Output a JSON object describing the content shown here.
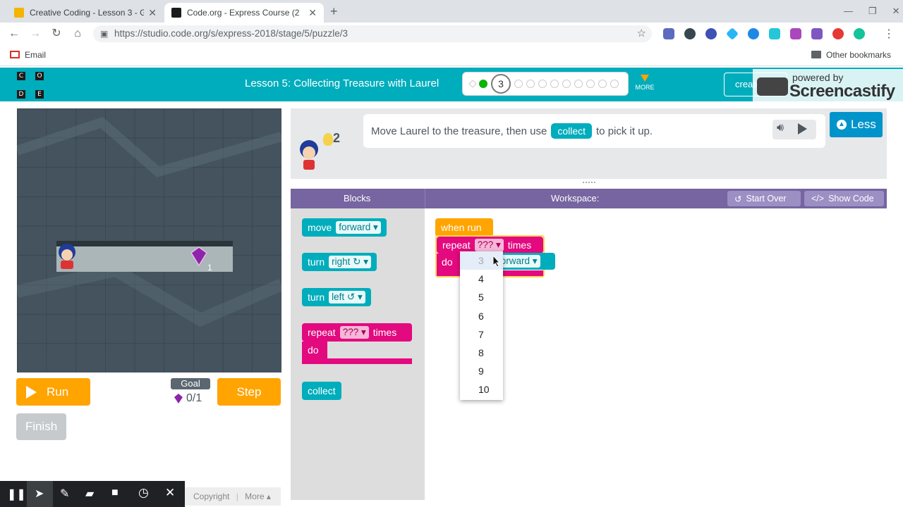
{
  "browser": {
    "tabs": [
      {
        "label": "Creative Coding - Lesson 3 - Goo",
        "favicon_color": "#f4b400"
      },
      {
        "label": "Code.org - Express Course (2",
        "favicon_color": "#1b1b1b"
      }
    ],
    "url_host": "https://studio.code.org",
    "url_path": "/s/express-2018/stage/5/puzzle/3",
    "bookmarks": {
      "email": "Email",
      "other": "Other bookmarks"
    }
  },
  "header": {
    "logo_letters": [
      "C",
      "O",
      "D",
      "E"
    ],
    "lesson_title": "Lesson 5: Collecting Treasure with Laurel",
    "current_puzzle": "3",
    "more_label": "MORE",
    "create_label": "create",
    "watermark_top": "powered by",
    "watermark_brand": "Screencastify"
  },
  "game": {
    "run_label": "Run",
    "goal_label": "Goal",
    "goal_count": "0/1",
    "treasure_count": "1",
    "step_label": "Step",
    "finish_label": "Finish"
  },
  "instructions": {
    "hint_count": "2",
    "text_before": "Move Laurel to the treasure, then use",
    "chip": "collect",
    "text_after": "to pick it up.",
    "less_label": "Less"
  },
  "workspace": {
    "blocks_header": "Blocks",
    "workspace_header": "Workspace:",
    "start_over": "Start Over",
    "show_code": "Show Code",
    "palette": {
      "move": "move",
      "forward": "forward",
      "turn": "turn",
      "right": "right ↻",
      "left": "left ↺",
      "repeat": "repeat",
      "qqq": "???",
      "times": "times",
      "do": "do",
      "collect": "collect"
    },
    "script": {
      "when_run": "when run",
      "repeat": "repeat",
      "qqq": "???",
      "times": "times",
      "do": "do",
      "forward_partial": "forward"
    },
    "dropdown_options": [
      "3",
      "4",
      "5",
      "6",
      "7",
      "8",
      "9",
      "10"
    ]
  },
  "footer": {
    "copyright": "Copyright",
    "more": "More ▴"
  }
}
